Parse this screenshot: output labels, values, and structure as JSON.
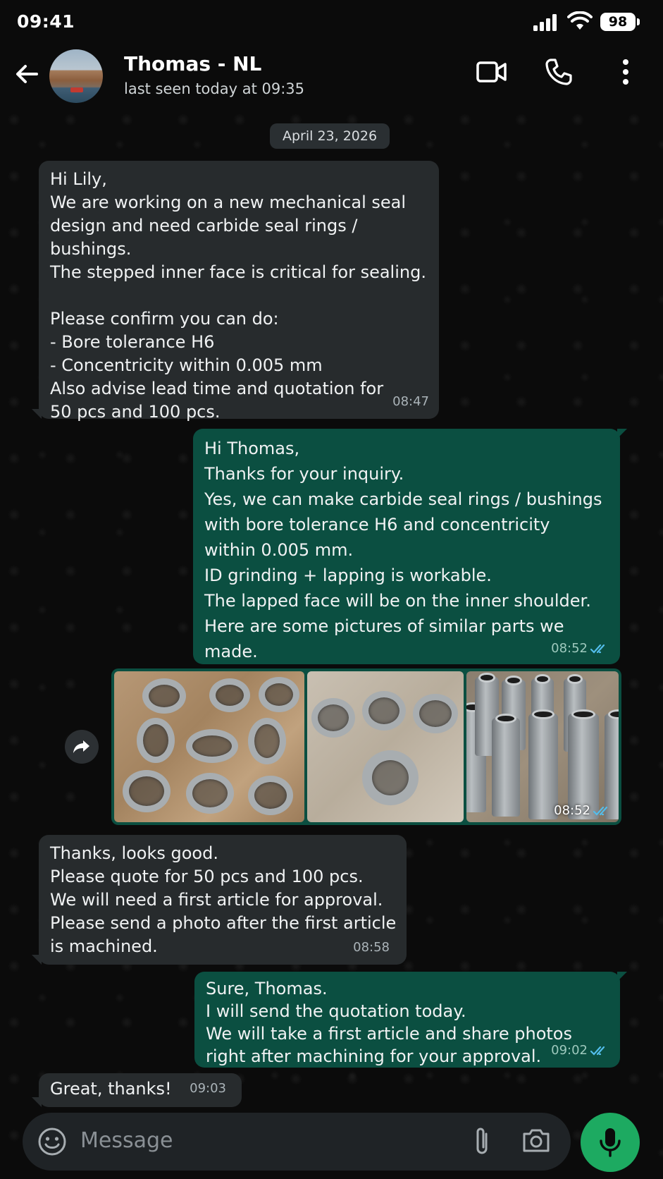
{
  "status_bar": {
    "time": "09:41",
    "battery": "98"
  },
  "header": {
    "back_icon": "arrow-left-icon",
    "contact_name": "Thomas - NL",
    "contact_status": "last seen today at 09:35",
    "actions": [
      "video-call-icon",
      "phone-icon",
      "more-vert-icon"
    ]
  },
  "conversation": {
    "date": "April 23, 2026",
    "messages": [
      {
        "direction": "in",
        "text": "Hi Lily,\nWe are working on a new mechanical seal design and need carbide seal rings / bushings.\nThe stepped inner face is critical for sealing.\n\nPlease confirm you can do:\n- Bore tolerance H6\n- Concentricity within 0.005 mm\nAlso advise lead time and quotation for\n50 pcs and 100 pcs.",
        "time": "08:47"
      },
      {
        "direction": "out",
        "text": "Hi Thomas,\nThanks for your inquiry.\nYes, we can make carbide seal rings / bushings\nwith bore tolerance H6 and concentricity\nwithin 0.005 mm.\nID grinding + lapping is workable.\nThe lapped face will be on the inner shoulder.\nHere are some pictures of similar parts we made.",
        "time": "08:52",
        "status": "read"
      },
      {
        "direction": "out",
        "type": "photos",
        "count": 3,
        "time": "08:52",
        "status": "read"
      },
      {
        "direction": "in",
        "text": "Thanks, looks good.\nPlease quote for 50 pcs and 100 pcs.\nWe will need a first article for approval.\nPlease send a photo after the first article\nis machined.",
        "time": "08:58"
      },
      {
        "direction": "out",
        "text": "Sure, Thomas.\nI will send the quotation today.\nWe will take a first article and share photos\nright after machining for your approval.",
        "time": "09:02",
        "status": "read"
      },
      {
        "direction": "in",
        "text": "Great, thanks!",
        "time": "09:03"
      }
    ]
  },
  "composer": {
    "placeholder": "Message",
    "icons": [
      "emoji-icon",
      "attach-icon",
      "camera-icon",
      "mic-icon"
    ]
  },
  "colors": {
    "incoming_bubble": "#272b2d",
    "outgoing_bubble": "#0b4f41",
    "read_tick": "#53bdeb",
    "mic_button": "#1daa61"
  }
}
